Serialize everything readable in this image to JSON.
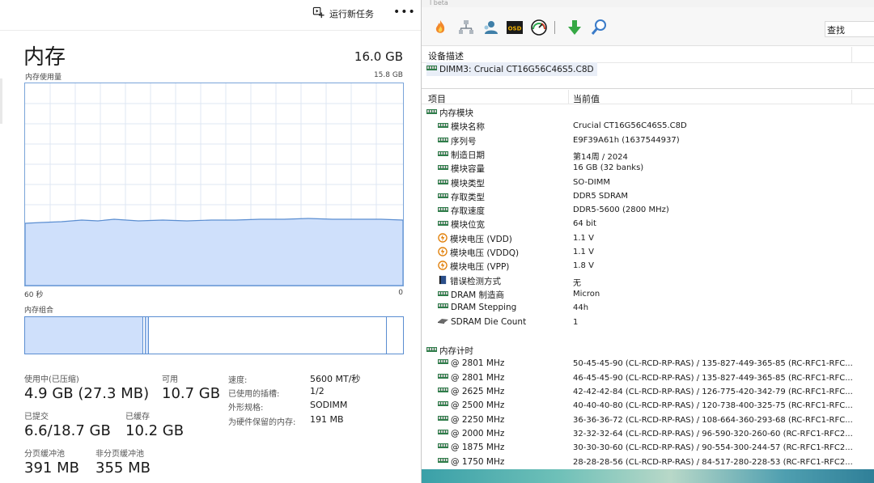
{
  "task_manager": {
    "toolbar": {
      "run_new_task": "运行新任务",
      "more": "•••"
    },
    "title": "内存",
    "total": "16.0 GB",
    "usage_label": "内存使用量",
    "usage_max": "15.8 GB",
    "axis_left": "60 秒",
    "axis_right": "0",
    "composition_label": "内存组合",
    "usage_fraction": 0.31,
    "colors": {
      "accent": "#5b8ed1",
      "fill": "#cfe0fb"
    },
    "stats": {
      "in_use_label": "使用中(已压缩)",
      "in_use_value": "4.9 GB (27.3 MB)",
      "available_label": "可用",
      "available_value": "10.7 GB",
      "committed_label": "已提交",
      "committed_value": "6.6/18.7 GB",
      "cached_label": "已缓存",
      "cached_value": "10.2 GB",
      "paged_label": "分页缓冲池",
      "paged_value": "391 MB",
      "nonpaged_label": "非分页缓冲池",
      "nonpaged_value": "355 MB"
    },
    "details": [
      {
        "label": "速度:",
        "value": "5600 MT/秒"
      },
      {
        "label": "已使用的插槽:",
        "value": "1/2"
      },
      {
        "label": "外形规格:",
        "value": "SODIMM"
      },
      {
        "label": "为硬件保留的内存:",
        "value": "191 MB"
      }
    ]
  },
  "aida": {
    "title_fragment": "l beta",
    "toolbar_icons": [
      "flame-icon",
      "network-icon",
      "user-icon",
      "osd-icon",
      "gauge-icon",
      "download-arrow-icon",
      "search-icon"
    ],
    "search_label": "查找",
    "device_header": "设备描述",
    "device_item": "DIMM3: Crucial CT16G56C46S5.C8D",
    "col_item": "项目",
    "col_value": "当前值",
    "module_section": "内存模块",
    "module_rows": [
      {
        "icon": "ram-icon",
        "label": "模块名称",
        "value": "Crucial CT16G56C46S5.C8D"
      },
      {
        "icon": "ram-icon",
        "label": "序列号",
        "value": "E9F39A61h (1637544937)"
      },
      {
        "icon": "ram-icon",
        "label": "制造日期",
        "value": "第14周 / 2024"
      },
      {
        "icon": "ram-icon",
        "label": "模块容量",
        "value": "16 GB (32 banks)"
      },
      {
        "icon": "ram-icon",
        "label": "模块类型",
        "value": "SO-DIMM"
      },
      {
        "icon": "ram-icon",
        "label": "存取类型",
        "value": "DDR5 SDRAM"
      },
      {
        "icon": "ram-icon",
        "label": "存取速度",
        "value": "DDR5-5600 (2800 MHz)"
      },
      {
        "icon": "ram-icon",
        "label": "模块位宽",
        "value": "64 bit"
      },
      {
        "icon": "voltage-icon",
        "label": "模块电压 (VDD)",
        "value": "1.1 V"
      },
      {
        "icon": "voltage-icon",
        "label": "模块电压 (VDDQ)",
        "value": "1.1 V"
      },
      {
        "icon": "voltage-icon",
        "label": "模块电压 (VPP)",
        "value": "1.8 V"
      },
      {
        "icon": "book-icon",
        "label": "错误检测方式",
        "value": "无"
      },
      {
        "icon": "ram-icon",
        "label": "DRAM 制造商",
        "value": "Micron"
      },
      {
        "icon": "ram-icon",
        "label": "DRAM Stepping",
        "value": "44h"
      },
      {
        "icon": "chip-icon",
        "label": "SDRAM Die Count",
        "value": "1"
      }
    ],
    "timing_section": "内存计时",
    "timing_rows": [
      {
        "label": "@ 2801 MHz",
        "value": "50-45-45-90  (CL-RCD-RP-RAS) / 135-827-449-365-85  (RC-RFC1-RFC..."
      },
      {
        "label": "@ 2801 MHz",
        "value": "46-45-45-90  (CL-RCD-RP-RAS) / 135-827-449-365-85  (RC-RFC1-RFC..."
      },
      {
        "label": "@ 2625 MHz",
        "value": "42-42-42-84  (CL-RCD-RP-RAS) / 126-775-420-342-79  (RC-RFC1-RFC..."
      },
      {
        "label": "@ 2500 MHz",
        "value": "40-40-40-80  (CL-RCD-RP-RAS) / 120-738-400-325-75  (RC-RFC1-RFC..."
      },
      {
        "label": "@ 2250 MHz",
        "value": "36-36-36-72  (CL-RCD-RP-RAS) / 108-664-360-293-68  (RC-RFC1-RFC..."
      },
      {
        "label": "@ 2000 MHz",
        "value": "32-32-32-64  (CL-RCD-RP-RAS) / 96-590-320-260-60  (RC-RFC1-RFC2..."
      },
      {
        "label": "@ 1875 MHz",
        "value": "30-30-30-60  (CL-RCD-RP-RAS) / 90-554-300-244-57  (RC-RFC1-RFC2..."
      },
      {
        "label": "@ 1750 MHz",
        "value": "28-28-28-56  (CL-RCD-RP-RAS) / 84-517-280-228-53  (RC-RFC1-RFC2..."
      }
    ]
  }
}
